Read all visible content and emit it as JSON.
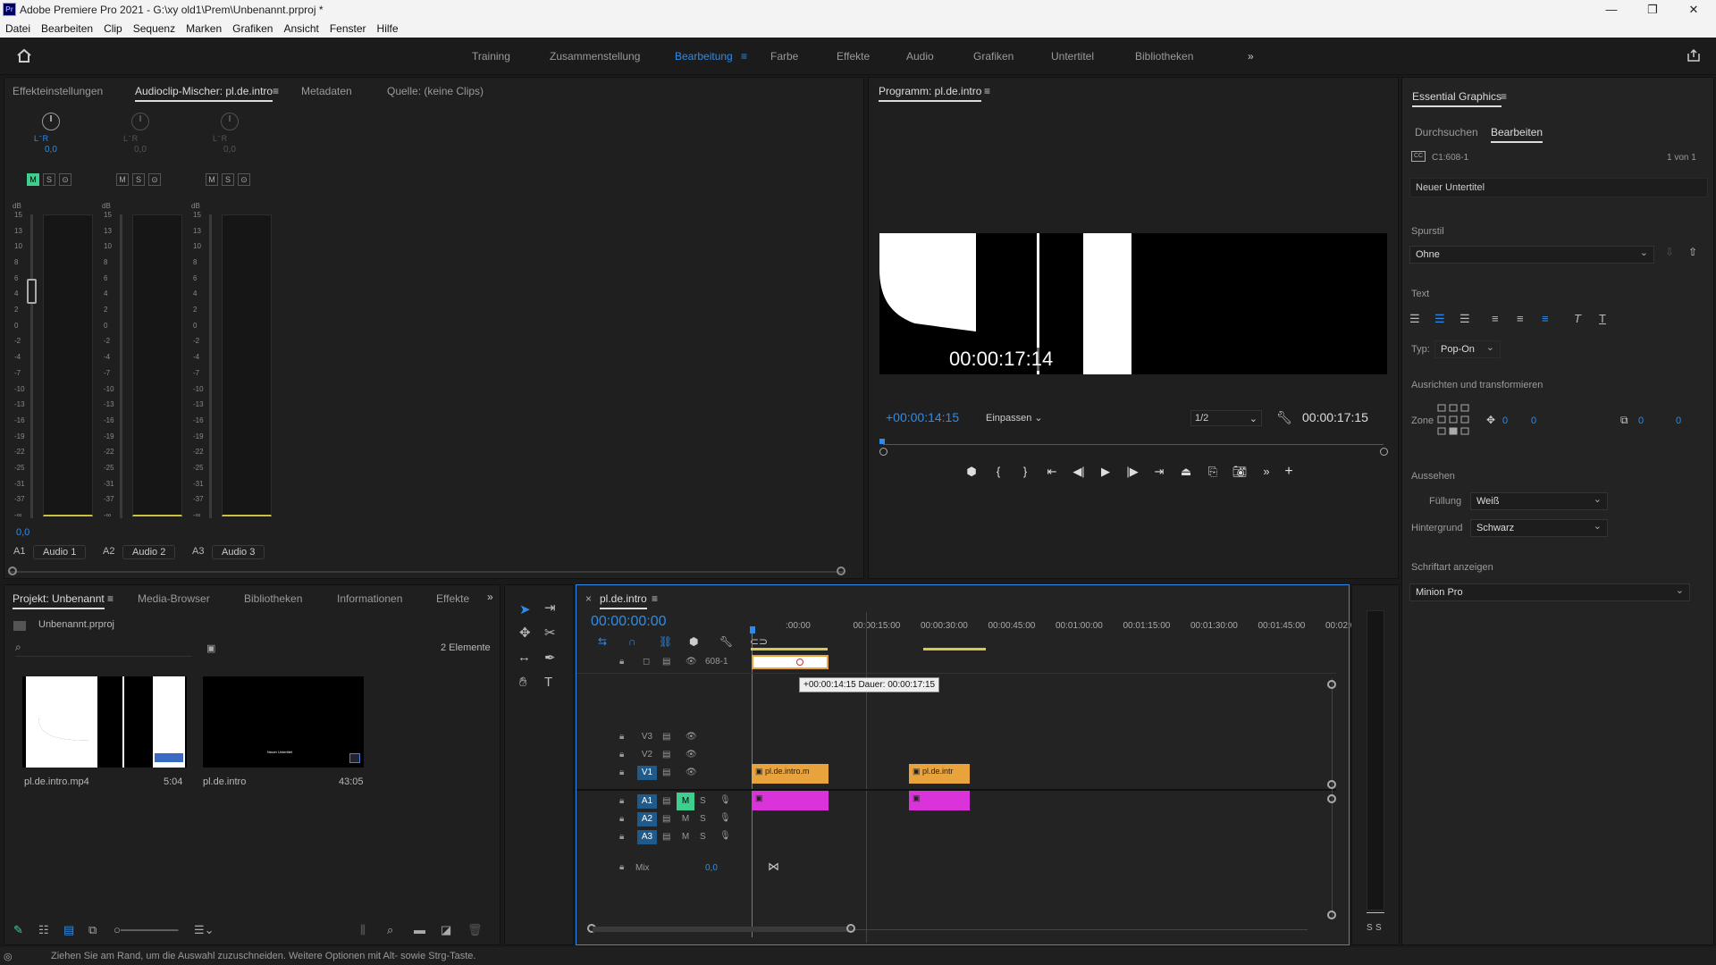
{
  "window": {
    "title": "Adobe Premiere Pro 2021 - G:\\xy old1\\Prem\\Unbenannt.prproj *",
    "minimize": "—",
    "maximize": "❐",
    "close": "✕"
  },
  "menu": [
    "Datei",
    "Bearbeiten",
    "Clip",
    "Sequenz",
    "Marken",
    "Grafiken",
    "Ansicht",
    "Fenster",
    "Hilfe"
  ],
  "workspaces": [
    "Training",
    "Zusammenstellung",
    "Bearbeitung",
    "Farbe",
    "Effekte",
    "Audio",
    "Grafiken",
    "Untertitel",
    "Bibliotheken"
  ],
  "workspace_active": "Bearbeitung",
  "source_panel": {
    "tabs": [
      "Effekteinstellungen",
      "Audioclip-Mischer: pl.de.intro",
      "Metadaten",
      "Quelle: (keine Clips)"
    ],
    "active": "Audioclip-Mischer: pl.de.intro"
  },
  "mixer": {
    "channels": [
      {
        "track": "A1",
        "name": "Audio 1",
        "lr": "L  ̄  R",
        "value": "0,0",
        "m": "M",
        "s": "S",
        "r": "⊙"
      },
      {
        "track": "A2",
        "name": "Audio 2",
        "lr": "L  ̄  R",
        "value": "0,0",
        "m": "M",
        "s": "S",
        "r": "⊙"
      },
      {
        "track": "A3",
        "name": "Audio 3",
        "lr": "L  ̄  R",
        "value": "0,0",
        "m": "M",
        "s": "S",
        "r": "⊙"
      }
    ],
    "db_unit": "dB",
    "db_ticks": [
      "15",
      "13",
      "10",
      "8",
      "6",
      "4",
      "2",
      "0",
      "-2",
      "-4",
      "-7",
      "-10",
      "-13",
      "-16",
      "-19",
      "-22",
      "-25",
      "-31",
      "-37",
      "-∞"
    ],
    "master_value": "0,0"
  },
  "program": {
    "title": "Programm: pl.de.intro",
    "timecode_overlay": "00:00:17:14",
    "current_time": "+00:00:14:15",
    "fit": "Einpassen",
    "resolution": "1/2",
    "duration": "00:00:17:15"
  },
  "essential_graphics": {
    "title": "Essential Graphics",
    "tabs": [
      "Durchsuchen",
      "Bearbeiten"
    ],
    "active_tab": "Bearbeiten",
    "caption_id": "C1:608-1",
    "count": "1 von 1",
    "caption_text": "Neuer Untertitel",
    "spurstil_label": "Spurstil",
    "spurstil": "Ohne",
    "text_label": "Text",
    "typ_label": "Typ:",
    "typ": "Pop-On",
    "align_label": "Ausrichten und transformieren",
    "zone_label": "Zone",
    "pos_x": "0",
    "pos_y": "0",
    "size_x": "0",
    "size_y": "0",
    "appearance_label": "Aussehen",
    "fill_label": "Füllung",
    "fill": "Weiß",
    "bg_label": "Hintergrund",
    "bg": "Schwarz",
    "font_label": "Schriftart anzeigen",
    "font": "Minion Pro"
  },
  "project": {
    "tabs": [
      "Projekt: Unbenannt",
      "Media-Browser",
      "Bibliotheken",
      "Informationen",
      "Effekte"
    ],
    "active": "Projekt: Unbenannt",
    "file": "Unbenannt.prproj",
    "count": "2 Elemente",
    "items": [
      {
        "name": "pl.de.intro.mp4",
        "duration": "5:04"
      },
      {
        "name": "pl.de.intro",
        "duration": "43:05",
        "caption": "Neuer Untertitel"
      }
    ]
  },
  "timeline": {
    "tab": "pl.de.intro",
    "timecode": "00:00:00:00",
    "ruler": [
      ":00:00",
      "00:00:15:00",
      "00:00:30:00",
      "00:00:45:00",
      "00:01:00:00",
      "00:01:15:00",
      "00:01:30:00",
      "00:01:45:00",
      "00:02:0"
    ],
    "caption_track": "608-1",
    "tooltip": "+00:00:14:15 Dauer: 00:00:17:15",
    "video_tracks": [
      "V3",
      "V2",
      "V1"
    ],
    "audio_tracks": [
      "A1",
      "A2",
      "A3"
    ],
    "mix_label": "Mix",
    "mix_value": "0,0",
    "clips": [
      {
        "name": "pl.de.intro.m"
      },
      {
        "name": "pl.de.intr"
      }
    ]
  },
  "meter_small": {
    "s1": "S",
    "s2": "S"
  },
  "status": "Ziehen Sie am Rand, um die Auswahl zuzuschneiden. Weitere Optionen mit Alt- sowie Strg-Taste.",
  "colors": {
    "accent": "#2d8ceb",
    "clip_video": "#e8a33c",
    "clip_audio": "#d933d9",
    "mute_green": "#3ecf8e"
  }
}
